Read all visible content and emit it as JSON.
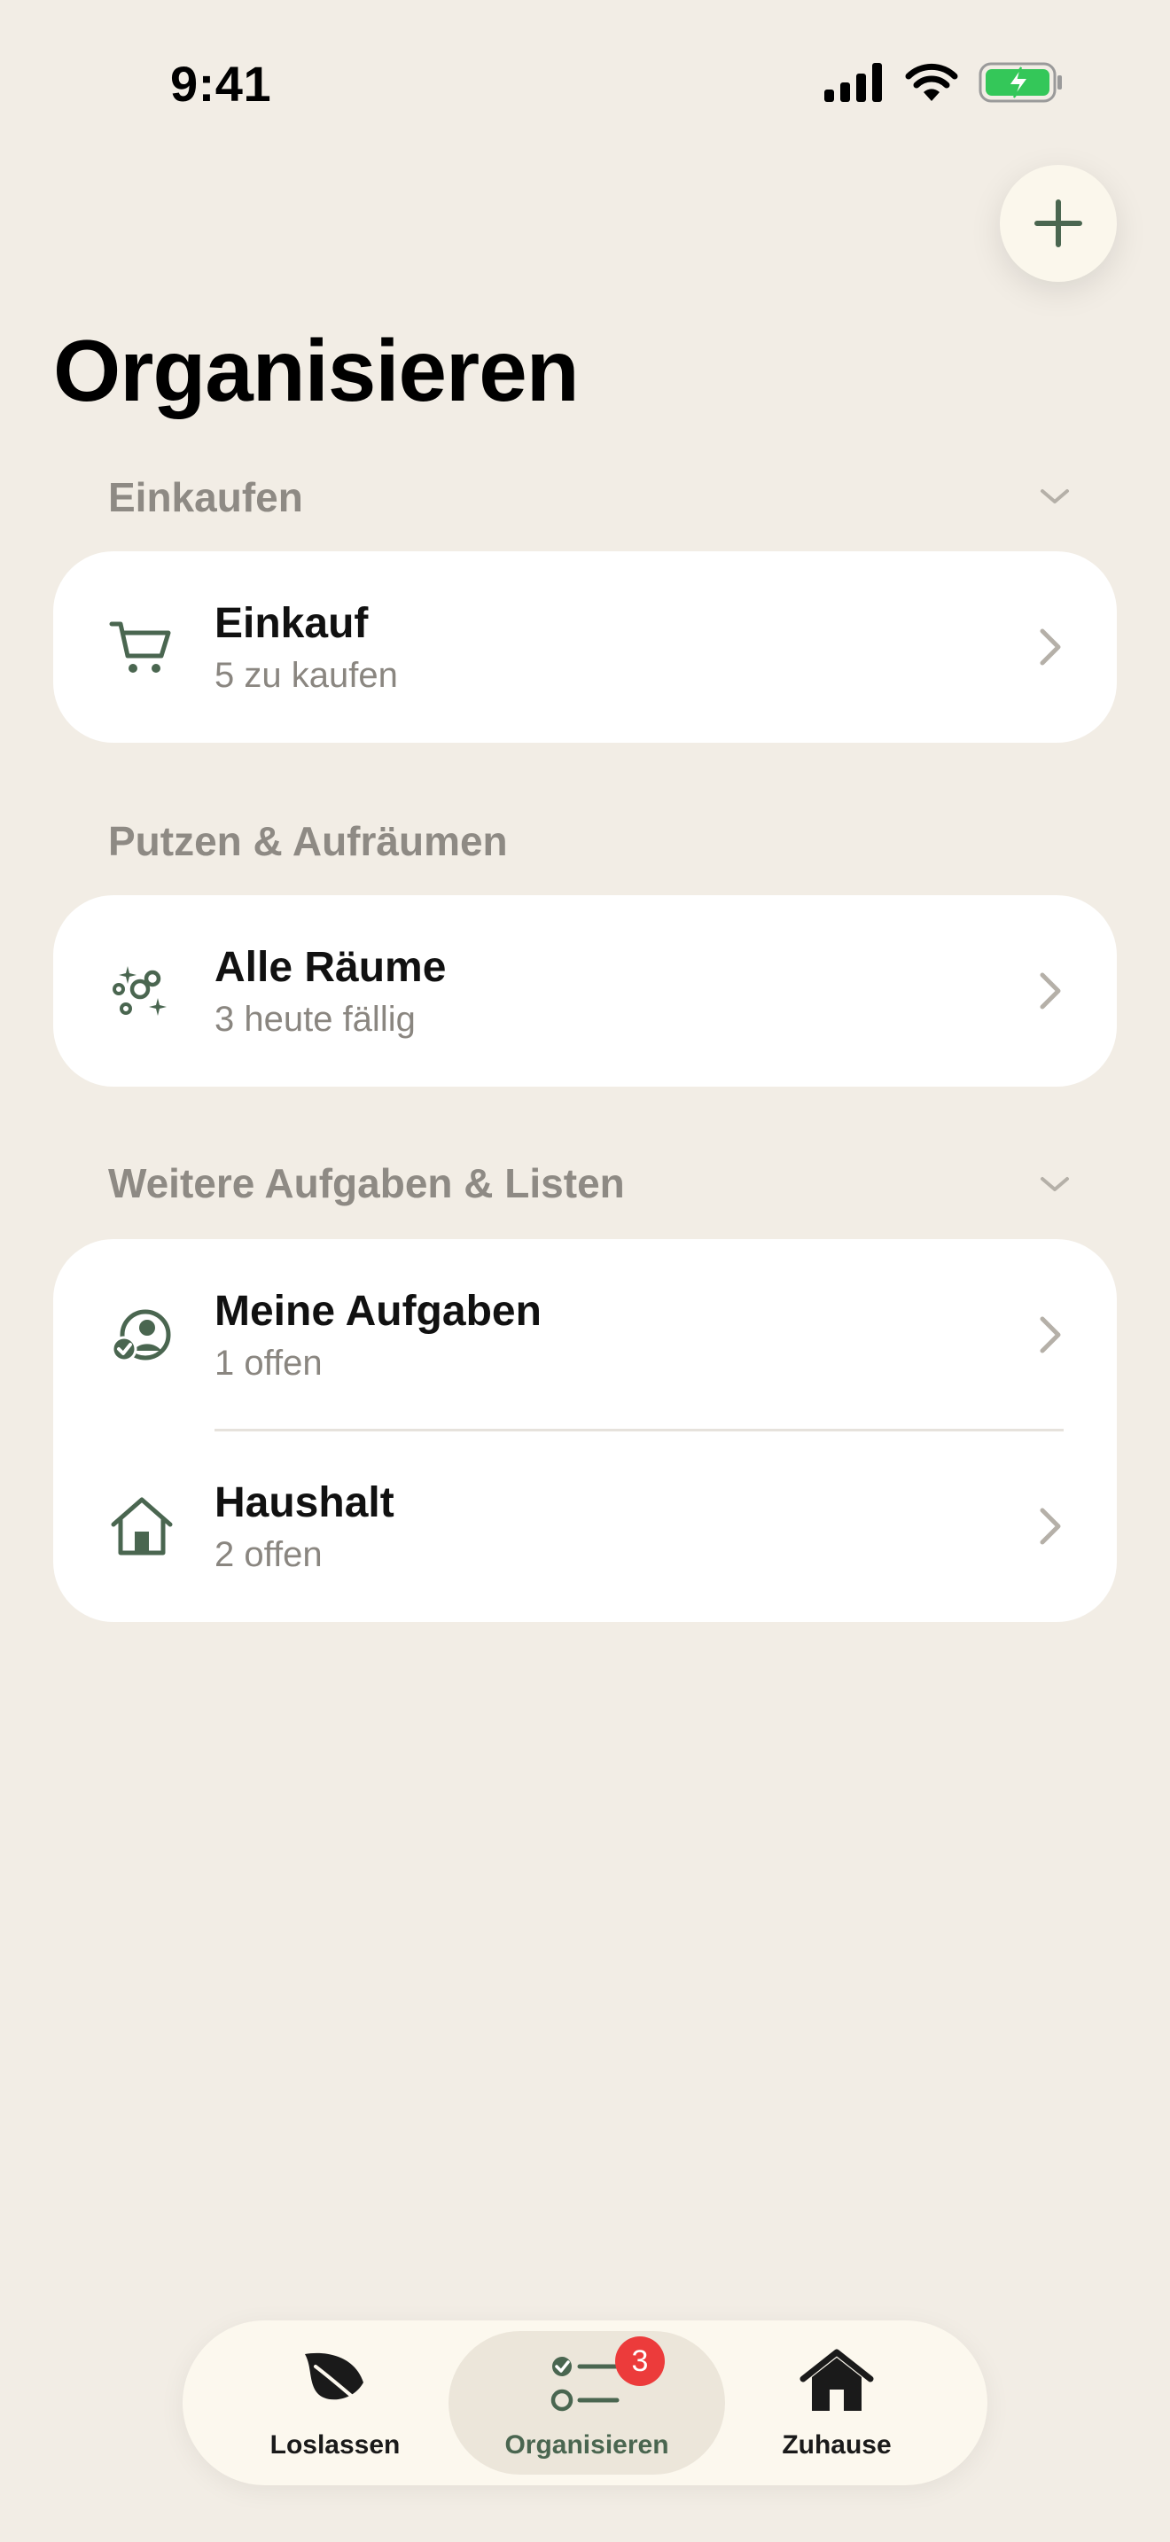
{
  "status_bar": {
    "time": "9:41"
  },
  "page": {
    "title": "Organisieren"
  },
  "sections": {
    "einkaufen": {
      "header": "Einkaufen",
      "items": [
        {
          "title": "Einkauf",
          "subtitle": "5 zu kaufen",
          "icon": "cart-icon"
        }
      ]
    },
    "putzen": {
      "header": "Putzen & Aufräumen",
      "items": [
        {
          "title": "Alle Räume",
          "subtitle": "3 heute fällig",
          "icon": "sparkle-bubbles-icon"
        }
      ]
    },
    "weitere": {
      "header": "Weitere Aufgaben & Listen",
      "items": [
        {
          "title": "Meine Aufgaben",
          "subtitle": "1 offen",
          "icon": "person-check-icon"
        },
        {
          "title": "Haushalt",
          "subtitle": "2 offen",
          "icon": "house-icon"
        }
      ]
    }
  },
  "tabbar": {
    "tabs": [
      {
        "label": "Loslassen",
        "icon": "leaf-icon"
      },
      {
        "label": "Organisieren",
        "icon": "checklist-icon",
        "badge": "3",
        "active": true
      },
      {
        "label": "Zuhause",
        "icon": "home-filled-icon"
      }
    ]
  },
  "colors": {
    "accent": "#4A6650",
    "background": "#F2EDE5",
    "badge": "#EC3B3B"
  }
}
